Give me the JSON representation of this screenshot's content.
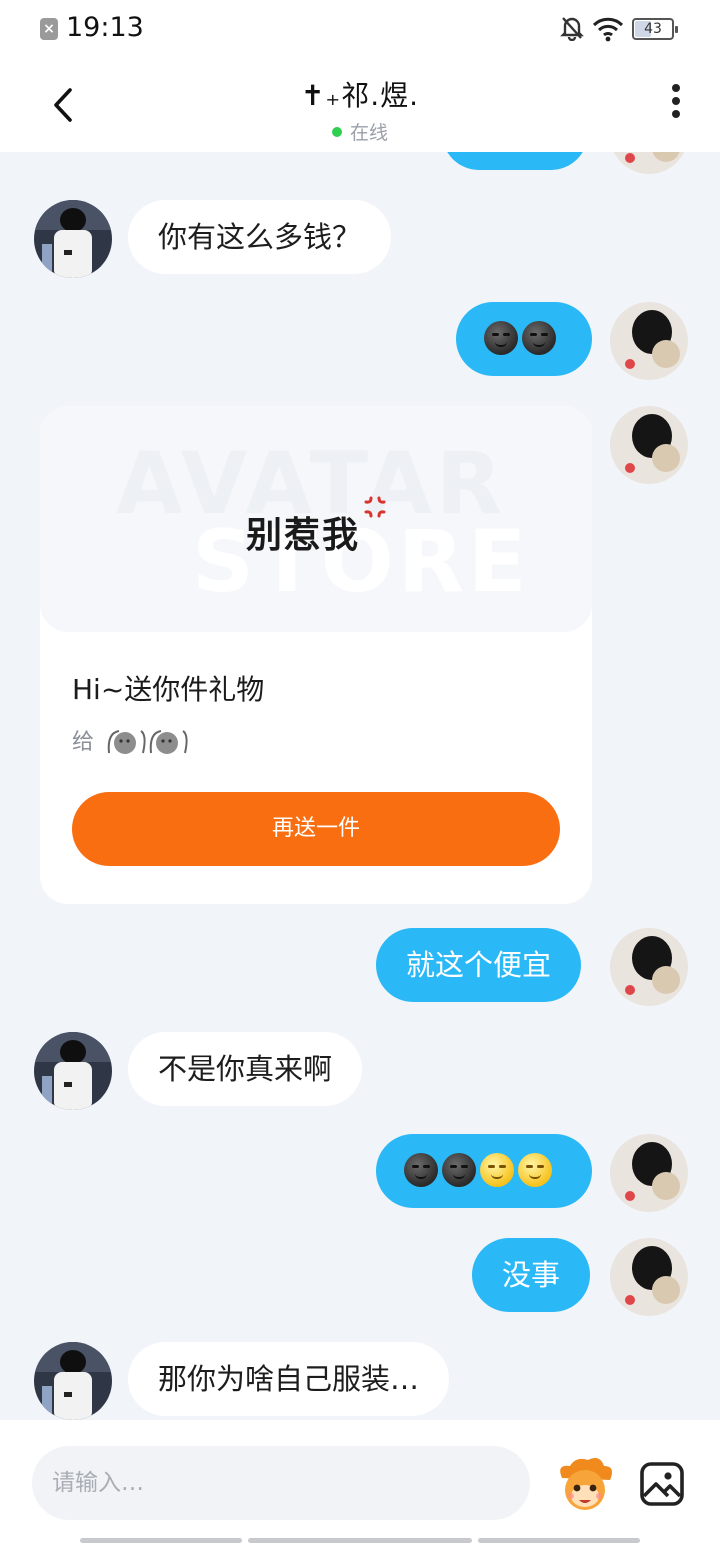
{
  "status_bar": {
    "time": "19:13",
    "battery": "43"
  },
  "header": {
    "title": "✝₊祁.煜.",
    "status": "在线"
  },
  "messages": {
    "m1": "你有这么多钱？",
    "m3": "就这个便宜",
    "m4": "不是你真来啊",
    "m6": "没事",
    "m7": "那你为啥自己服装…"
  },
  "gift": {
    "watermark_top": "AVATAR",
    "watermark_bottom": "STORE",
    "sticker_text": "别惹我",
    "title": "Hi~送你件礼物",
    "to_label": "给",
    "resend_label": "再送一件"
  },
  "composer": {
    "placeholder": "请输入…"
  },
  "colors": {
    "outgoing_bubble": "#2bb8f6",
    "incoming_bubble": "#ffffff",
    "resend_button": "#fa6e12",
    "online_dot": "#2fd04f",
    "background": "#f1f4f9"
  },
  "icons": [
    "back-arrow-icon",
    "more-vertical-icon",
    "mascot-sticker-icon",
    "image-icon"
  ]
}
